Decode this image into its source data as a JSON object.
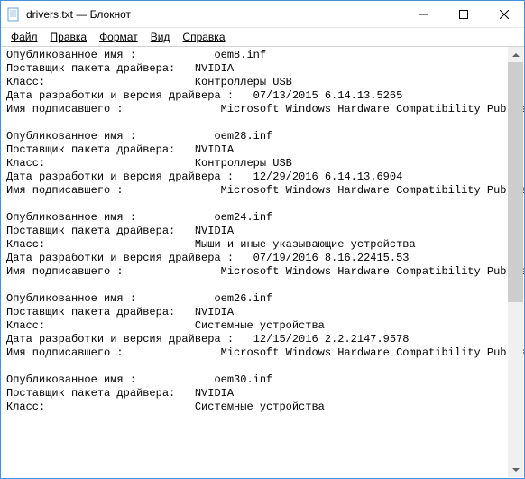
{
  "window": {
    "title": "drivers.txt — Блокнот"
  },
  "menu": {
    "file": "Файл",
    "edit": "Правка",
    "format": "Формат",
    "view": "Вид",
    "help": "Справка"
  },
  "content": {
    "text": "Опубликованное имя :            oem8.inf\nПоставщик пакета драйвера:   NVIDIA\nКласс:                       Контроллеры USB\nДата разработки и версия драйвера :   07/13/2015 6.14.13.5265\nИмя подписавшего :               Microsoft Windows Hardware Compatibility Publisher\n\nОпубликованное имя :            oem28.inf\nПоставщик пакета драйвера:   NVIDIA\nКласс:                       Контроллеры USB\nДата разработки и версия драйвера :   12/29/2016 6.14.13.6904\nИмя подписавшего :               Microsoft Windows Hardware Compatibility Publisher\n\nОпубликованное имя :            oem24.inf\nПоставщик пакета драйвера:   NVIDIA\nКласс:                       Мыши и иные указывающие устройства\nДата разработки и версия драйвера :   07/19/2016 8.16.22415.53\nИмя подписавшего :               Microsoft Windows Hardware Compatibility Publisher\n\nОпубликованное имя :            oem26.inf\nПоставщик пакета драйвера:   NVIDIA\nКласс:                       Системные устройства\nДата разработки и версия драйвера :   12/15/2016 2.2.2147.9578\nИмя подписавшего :               Microsoft Windows Hardware Compatibility Publisher\n\nОпубликованное имя :            oem30.inf\nПоставщик пакета драйвера:   NVIDIA\nКласс:                       Системные устройства"
  }
}
